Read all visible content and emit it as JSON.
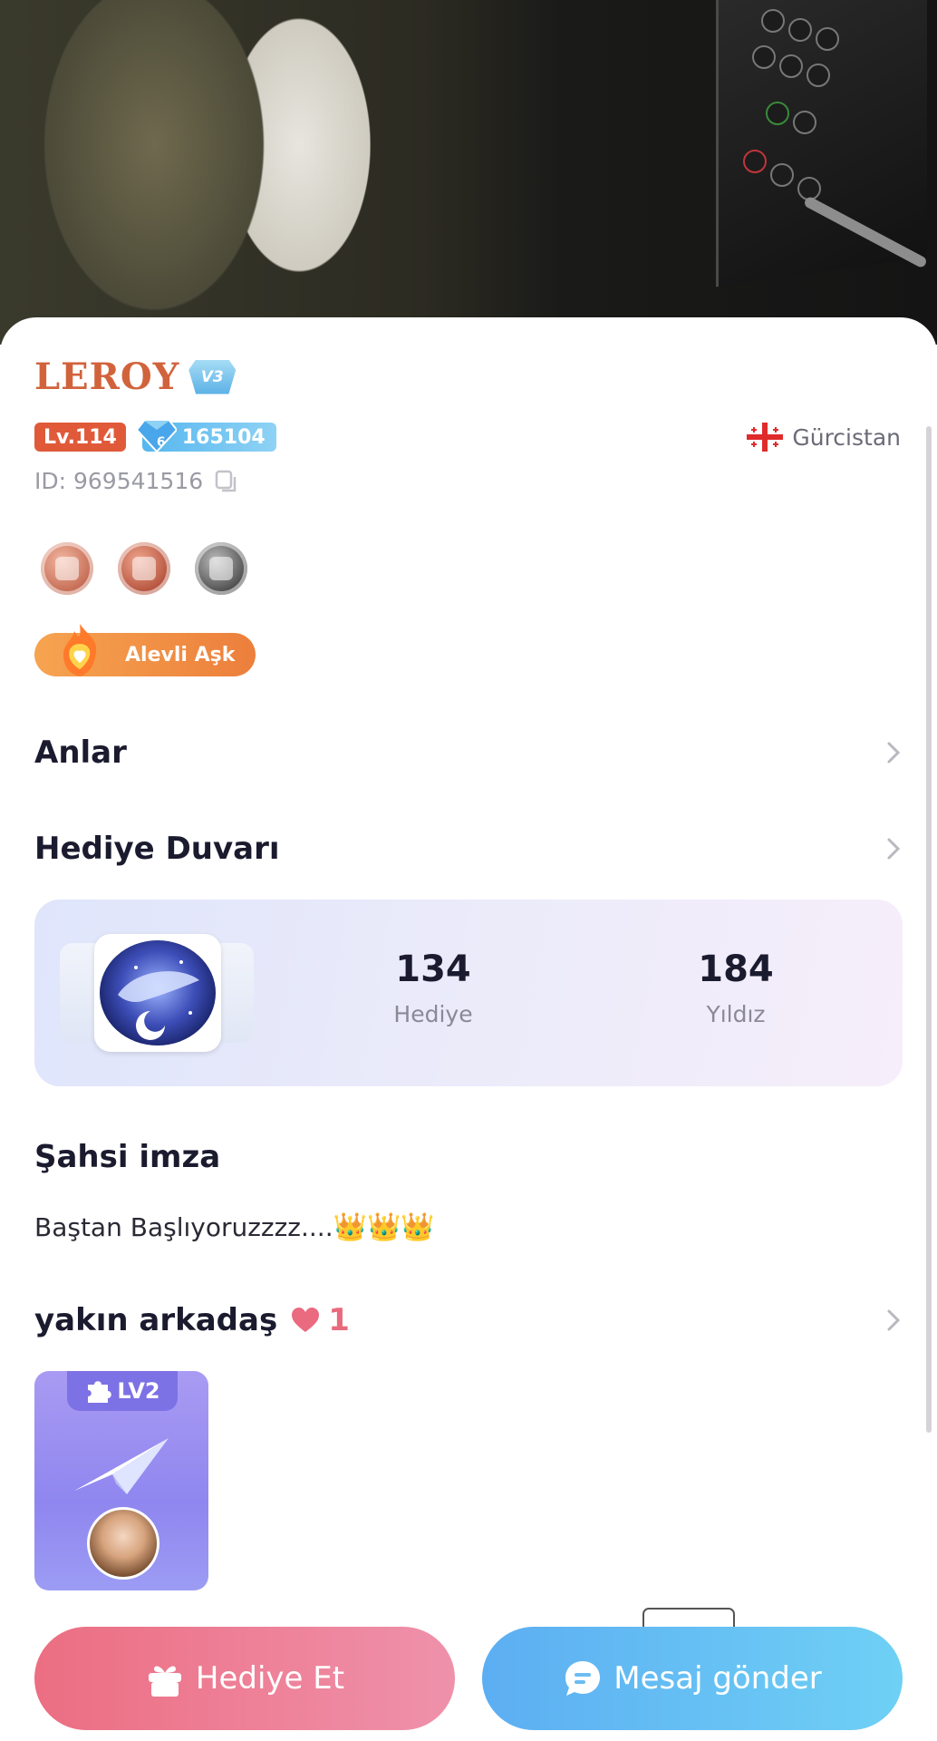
{
  "profile": {
    "username": "LEROY",
    "vip_level": "V3",
    "level": "Lv.114",
    "diamond_level": "6",
    "diamonds": "165104",
    "country": "Gürcistan",
    "id_text": "ID: 969541516",
    "badge_label": "Alevli Aşk"
  },
  "sections": {
    "moments": "Anlar",
    "gift_wall": "Hediye Duvarı",
    "signature": "Şahsi imza",
    "close_friend": "yakın arkadaş"
  },
  "gift_wall": {
    "gift_count": "134",
    "gift_label": "Hediye",
    "star_count": "184",
    "star_label": "Yıldız"
  },
  "signature": {
    "text": "Baştan Başlıyoruzzzz....",
    "emojis": "👑👑👑"
  },
  "close_friend": {
    "count": "1",
    "friend_level": "LV2"
  },
  "actions": {
    "gift_button": "Hediye Et",
    "message_button": "Mesaj gönder"
  },
  "colors": {
    "username": "#d1633c",
    "level_tag": "#e05a3a",
    "diamond_tag": "#56b7ee",
    "gift_button": "#ec6e82",
    "message_button": "#5caef2"
  }
}
